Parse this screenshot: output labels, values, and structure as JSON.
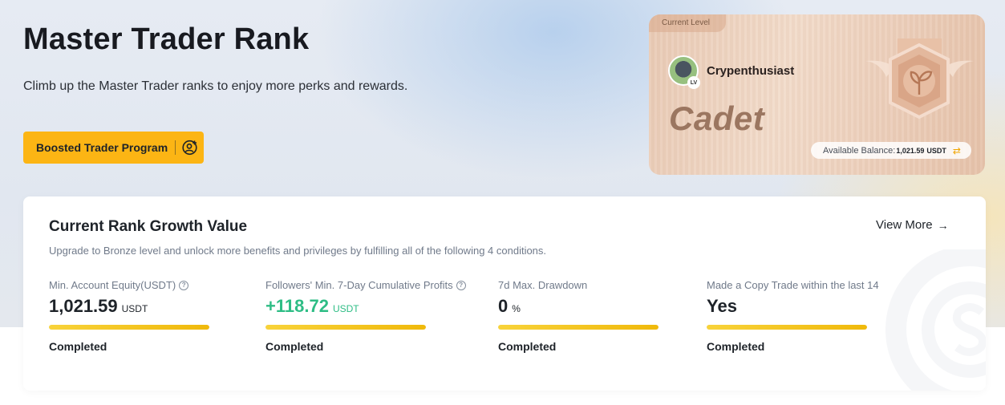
{
  "header": {
    "title": "Master Trader Rank",
    "subtitle": "Climb up the Master Trader ranks to enjoy more perks and rewards.",
    "boosted_button_label": "Boosted Trader Program"
  },
  "level_card": {
    "tag": "Current Level",
    "username": "Crypenthusiast",
    "avatar_badge": "LV",
    "rank": "Cadet",
    "balance_label": "Available Balance:",
    "balance_value": "1,021.59",
    "balance_currency": "USDT"
  },
  "growth": {
    "title": "Current Rank Growth Value",
    "view_more_label": "View More",
    "description": "Upgrade to Bronze level and unlock more benefits and privileges by fulfilling all of the following 4 conditions.",
    "conditions": [
      {
        "label": "Min. Account Equity(USDT)",
        "value": "1,021.59",
        "unit": "USDT",
        "status": "Completed",
        "progress": 1.0,
        "help": true
      },
      {
        "label": "Followers' Min. 7-Day Cumulative Profits",
        "value": "+118.72",
        "unit": "USDT",
        "status": "Completed",
        "progress": 1.0,
        "help": true
      },
      {
        "label": "7d Max. Drawdown",
        "value": "0",
        "unit": "%",
        "status": "Completed",
        "progress": 1.0,
        "help": false
      },
      {
        "label": "Made a Copy Trade within the last 14",
        "value": "Yes",
        "unit": "",
        "status": "Completed",
        "progress": 1.0,
        "help": false
      }
    ]
  },
  "colors": {
    "accent": "#fcb514",
    "positive": "#2ebd85",
    "progress": "#f0b90b"
  },
  "icons": {
    "boosted": "add-user-icon",
    "help": "question-circle-icon",
    "view_more": "arrow-right-icon",
    "balance": "swap-icon",
    "badge": "sprout-badge-icon"
  }
}
